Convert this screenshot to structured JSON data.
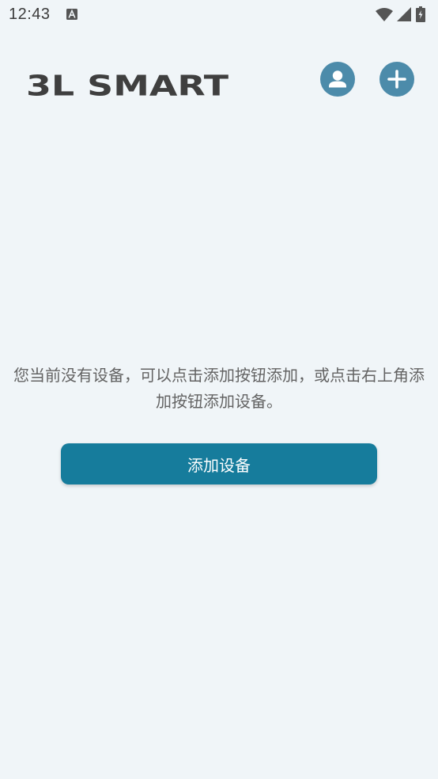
{
  "status_bar": {
    "time": "12:43",
    "notification_icon": "accessibility-a-icon",
    "wifi_icon": "wifi-icon",
    "signal_icon": "cell-signal-icon",
    "battery_icon": "battery-charging-icon"
  },
  "header": {
    "logo_text": "3L SMART",
    "user_icon": "user-account-icon",
    "add_icon": "plus-icon"
  },
  "empty_state": {
    "message": "您当前没有设备，可以点击添加按钮添加，或点击右上角添加按钮添加设备。",
    "add_button_label": "添加设备"
  },
  "colors": {
    "background": "#F0F5F8",
    "header_button": "#4C8BAA",
    "primary_button": "#167C9C",
    "logo": "#3F3F3F",
    "message_text": "#636363"
  }
}
